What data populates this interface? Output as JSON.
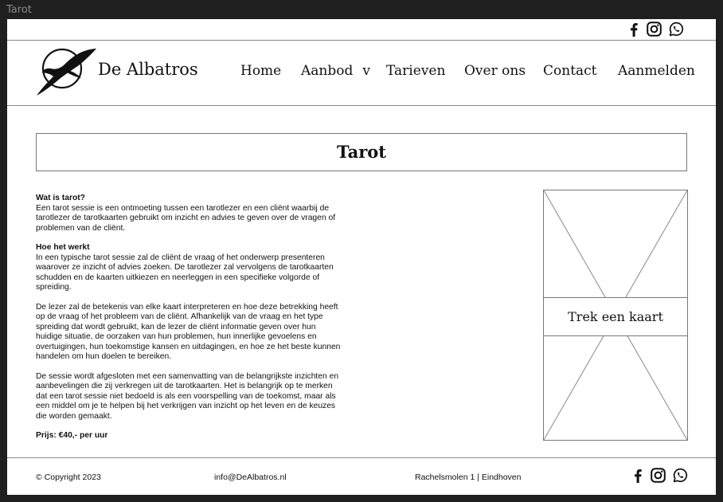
{
  "window": {
    "title": "Tarot"
  },
  "brand": {
    "name": "De Albatros",
    "logo_icon": "albatross-logo-icon"
  },
  "social": [
    "facebook-icon",
    "instagram-icon",
    "whatsapp-icon"
  ],
  "nav": {
    "home": "Home",
    "aanbod": "Aanbod",
    "aanbod_caret": "v",
    "tarieven": "Tarieven",
    "over_ons": "Over ons",
    "contact": "Contact",
    "aanmelden": "Aanmelden"
  },
  "page": {
    "title": "Tarot"
  },
  "content": {
    "s1_heading": "Wat is tarot?",
    "s1_text": "Een tarot sessie is een ontmoeting tussen een tarotlezer en een cliënt waarbij de tarotlezer de tarotkaarten gebruikt om inzicht en advies te geven over de vragen of problemen van de cliënt.",
    "s2_heading": "Hoe het werkt",
    "s2_text": "In een typische tarot sessie zal de cliënt de vraag of het onderwerp presenteren waarover ze inzicht of advies zoeken. De tarotlezer zal vervolgens de tarotkaarten schudden en de kaarten uitkiezen en neerleggen in een specifieke volgorde of spreiding.",
    "p3": "De lezer zal de betekenis van elke kaart interpreteren en hoe deze betrekking heeft op de vraag of het probleem van de cliënt. Afhankelijk van de vraag en het type spreiding dat wordt gebruikt, kan de lezer de cliënt informatie geven over hun huidige situatie, de oorzaken van hun problemen, hun innerlijke gevoelens en overtuigingen, hun toekomstige kansen en uitdagingen, en hoe ze het beste kunnen handelen om hun doelen te bereiken.",
    "p4": "De sessie wordt afgesloten met een samenvatting van de belangrijkste inzichten en aanbevelingen die zij verkregen uit de tarotkaarten. Het is belangrijk op te merken dat een tarot sessie niet bedoeld is als een voorspelling van de toekomst, maar als een middel om je te helpen bij het verkrijgen van inzicht op het leven en de keuzes die worden gemaakt.",
    "price": "Prijs: €40,- per uur"
  },
  "card": {
    "label": "Trek een kaart"
  },
  "footer": {
    "copyright": "© Copyright 2023",
    "email": "info@DeAlbatros.nl",
    "address": "Rachelsmolen 1 | Eindhoven"
  },
  "colors": {
    "background": "#ffffff",
    "frame": "#1f1f1f",
    "lines": "#777777",
    "text": "#111111"
  }
}
